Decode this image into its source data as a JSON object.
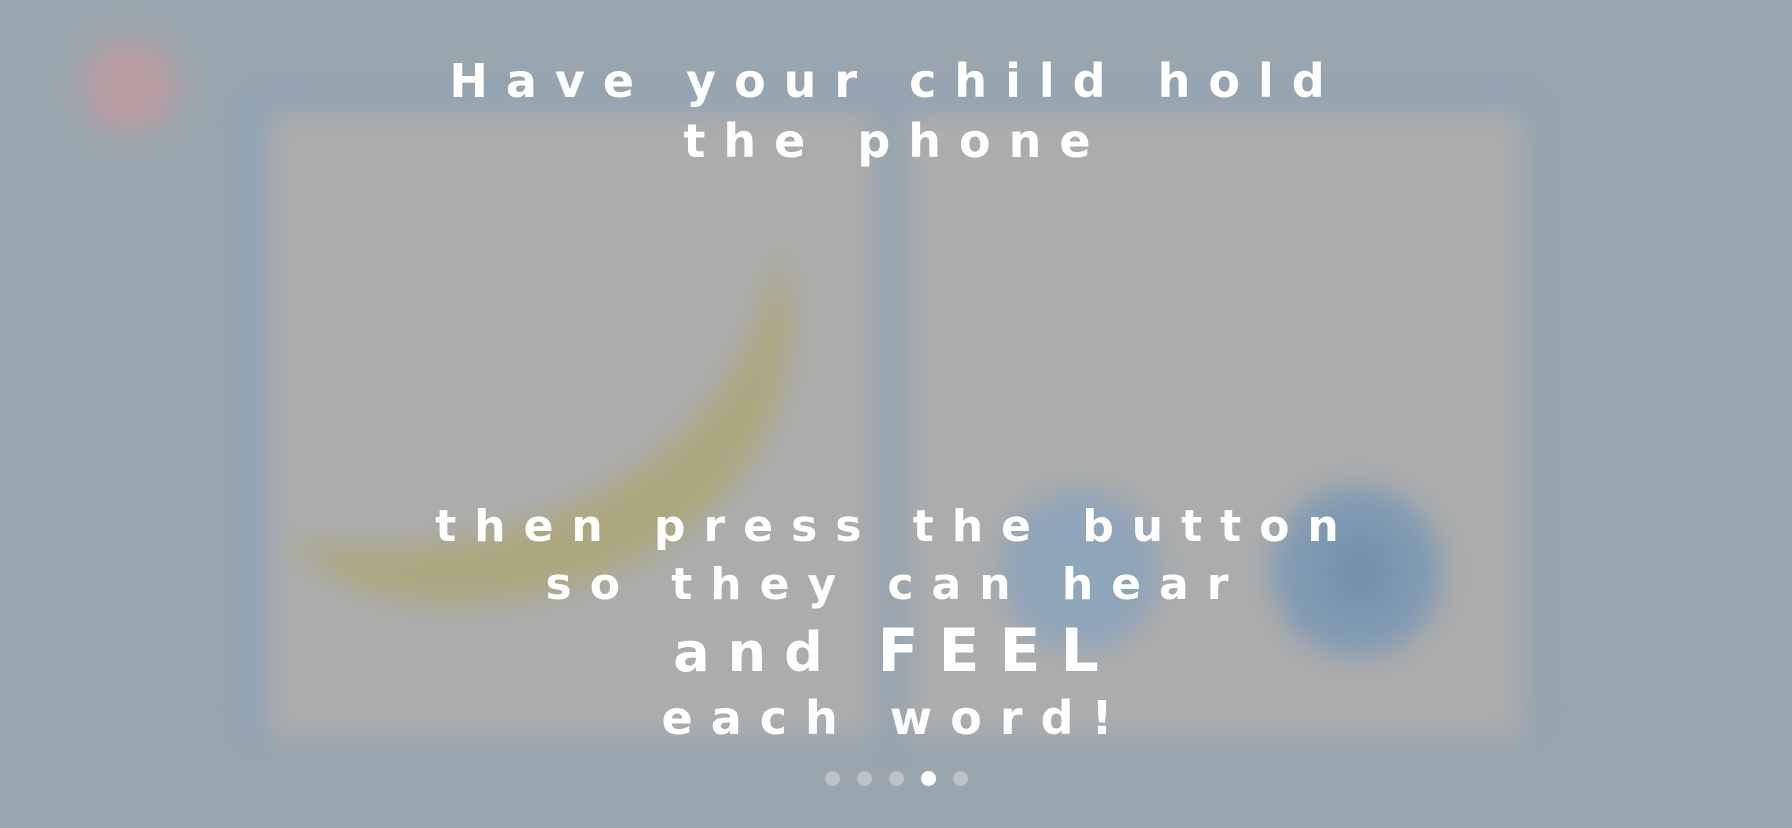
{
  "overlay": {
    "heading_line1": "Have your child hold",
    "heading_line2": "the phone",
    "body_line1": "then press the button",
    "body_line2": "so they can hear",
    "body_line3_prefix": "and ",
    "body_line3_emphasis": "FEEL",
    "body_line4": "each word!"
  },
  "pager": {
    "total_pages": 5,
    "current_page": 4
  },
  "background": {
    "close_icon": "close-circle-icon",
    "illustration": "banana-icon",
    "play_icon": "play-button-icon",
    "speaker_icon": "speaker-button-icon"
  },
  "colors": {
    "overlay_tint": "#9aa6af",
    "text": "#ffffff",
    "dot_inactive": "#bcc3c9",
    "dot_active": "#ffffff"
  }
}
